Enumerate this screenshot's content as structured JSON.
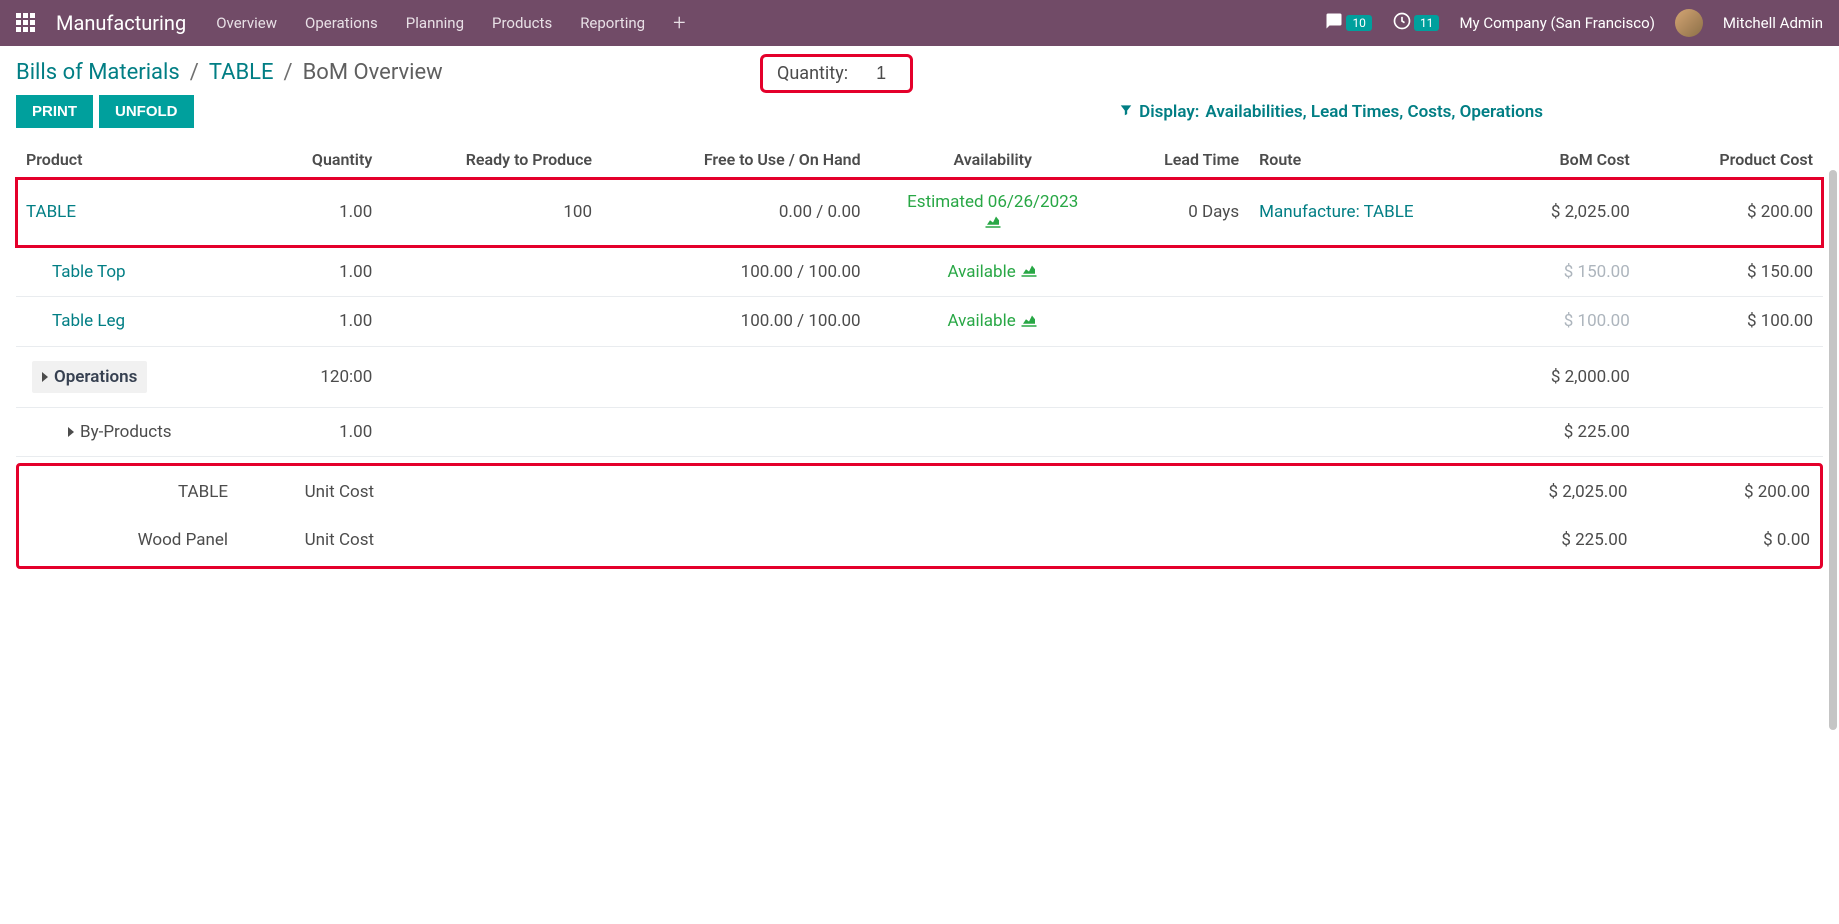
{
  "navbar": {
    "brand": "Manufacturing",
    "menu": [
      "Overview",
      "Operations",
      "Planning",
      "Products",
      "Reporting"
    ],
    "messages_badge": "10",
    "activities_badge": "11",
    "company": "My Company (San Francisco)",
    "user": "Mitchell Admin"
  },
  "breadcrumb": {
    "items": [
      "Bills of Materials",
      "TABLE",
      "BoM Overview"
    ]
  },
  "quantity": {
    "label": "Quantity:",
    "value": "1"
  },
  "buttons": {
    "print": "PRINT",
    "unfold": "UNFOLD"
  },
  "display_filter": {
    "prefix": "Display:",
    "value": "Availabilities, Lead Times, Costs, Operations"
  },
  "columns": {
    "product": "Product",
    "quantity": "Quantity",
    "ready": "Ready to Produce",
    "free": "Free to Use / On Hand",
    "availability": "Availability",
    "lead": "Lead Time",
    "route": "Route",
    "bom_cost": "BoM Cost",
    "product_cost": "Product Cost"
  },
  "rows": {
    "main": {
      "product": "TABLE",
      "quantity": "1.00",
      "ready": "100",
      "free": "0.00 / 0.00",
      "availability": "Estimated 06/26/2023",
      "lead": "0 Days",
      "route": "Manufacture: TABLE",
      "bom_cost": "$ 2,025.00",
      "product_cost": "$ 200.00"
    },
    "comp1": {
      "product": "Table Top",
      "quantity": "1.00",
      "free": "100.00 / 100.00",
      "availability": "Available",
      "bom_cost": "$ 150.00",
      "product_cost": "$ 150.00"
    },
    "comp2": {
      "product": "Table Leg",
      "quantity": "1.00",
      "free": "100.00 / 100.00",
      "availability": "Available",
      "bom_cost": "$ 100.00",
      "product_cost": "$ 100.00"
    },
    "ops": {
      "label": "Operations",
      "quantity": "120:00",
      "bom_cost": "$ 2,000.00"
    },
    "byp": {
      "label": "By-Products",
      "quantity": "1.00",
      "bom_cost": "$ 225.00"
    },
    "sum1": {
      "product": "TABLE",
      "quantity": "Unit Cost",
      "bom_cost": "$ 2,025.00",
      "product_cost": "$ 200.00"
    },
    "sum2": {
      "product": "Wood Panel",
      "quantity": "Unit Cost",
      "bom_cost": "$ 225.00",
      "product_cost": "$ 0.00"
    }
  }
}
